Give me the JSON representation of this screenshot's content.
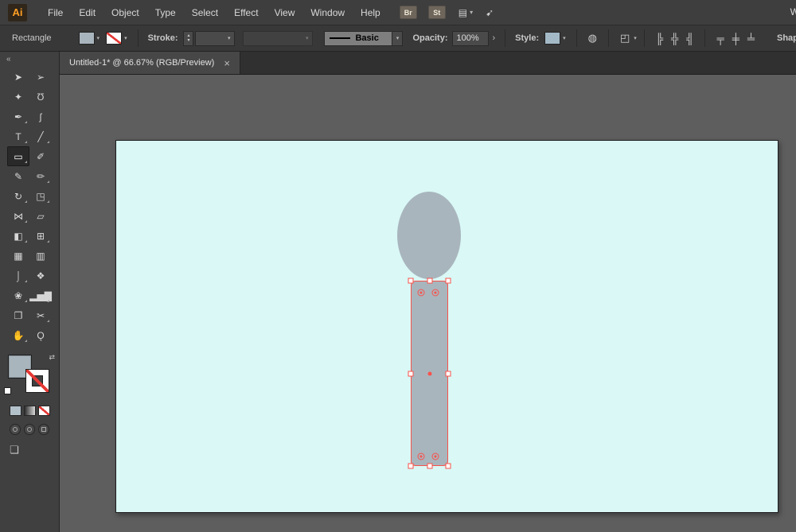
{
  "colors": {
    "menubar-bg": "#3e3e3e",
    "controlbar-bg": "#383838",
    "panel-bg": "#404040",
    "tabbar-bg": "#303030",
    "tab-bg": "#474747",
    "canvas-bg": "#5e5e5e",
    "artboard-bg": "#d9f8f6",
    "shape-fill": "#a9b5bd",
    "selection": "#f8524b",
    "text-light": "#d9d9d9",
    "logo-amber": "#ff9f24"
  },
  "menubar": {
    "logo": "Ai",
    "items": [
      "File",
      "Edit",
      "Object",
      "Type",
      "Select",
      "Effect",
      "View",
      "Window",
      "Help"
    ],
    "bridge_label": "Br",
    "stock_label": "St",
    "right_partial": "W"
  },
  "controlbar": {
    "context_label": "Rectangle",
    "stroke_label": "Stroke:",
    "stroke_weight_value": "",
    "brush_value": "Basic",
    "opacity_label": "Opacity:",
    "opacity_value": "100%",
    "style_label": "Style:",
    "shape_label": "Shape"
  },
  "tab": {
    "title": "Untitled-1* @ 66.67% (RGB/Preview)"
  },
  "icons": {
    "chevron_down": "▾",
    "chevron_right": "›",
    "stepper_up": "▴",
    "stepper_down": "▾",
    "arrange_documents": "▤",
    "gpu_performance": "➹",
    "swap_arrows": "⇄",
    "recolor_artwork": "◍",
    "select_similar": "◰",
    "align_h_left": "╠",
    "align_h_center": "╬",
    "align_h_right": "╣",
    "align_v_top": "╤",
    "align_v_center": "╪",
    "align_v_bottom": "╧",
    "screen_mode": "❏",
    "collapse_panel": "«",
    "close": "×"
  },
  "toolbar": {
    "tools": [
      {
        "name": "selection-tool",
        "glyph": "➤"
      },
      {
        "name": "direct-selection-tool",
        "glyph": "➢"
      },
      {
        "name": "magic-wand-tool",
        "glyph": "✦"
      },
      {
        "name": "lasso-tool",
        "glyph": "Ʊ"
      },
      {
        "name": "pen-tool",
        "glyph": "✒"
      },
      {
        "name": "curvature-tool",
        "glyph": "ʃ"
      },
      {
        "name": "type-tool",
        "glyph": "T"
      },
      {
        "name": "line-segment-tool",
        "glyph": "╱"
      },
      {
        "name": "rectangle-tool",
        "glyph": "▭",
        "selected": true
      },
      {
        "name": "paintbrush-tool",
        "glyph": "✐"
      },
      {
        "name": "shaper-tool",
        "glyph": "✎"
      },
      {
        "name": "pencil-tool",
        "glyph": "✏"
      },
      {
        "name": "rotate-tool",
        "glyph": "↻"
      },
      {
        "name": "scale-tool",
        "glyph": "◳"
      },
      {
        "name": "width-tool",
        "glyph": "⋈"
      },
      {
        "name": "free-transform-tool",
        "glyph": "▱"
      },
      {
        "name": "shape-builder-tool",
        "glyph": "◧"
      },
      {
        "name": "perspective-grid-tool",
        "glyph": "⊞"
      },
      {
        "name": "mesh-tool",
        "glyph": "▦"
      },
      {
        "name": "gradient-tool",
        "glyph": "▥"
      },
      {
        "name": "eyedropper-tool",
        "glyph": "⌡"
      },
      {
        "name": "blend-tool",
        "glyph": "❖"
      },
      {
        "name": "symbol-sprayer-tool",
        "glyph": "❀"
      },
      {
        "name": "column-graph-tool",
        "glyph": "▂▅▇"
      },
      {
        "name": "artboard-tool",
        "glyph": "❐"
      },
      {
        "name": "slice-tool",
        "glyph": "✂"
      },
      {
        "name": "hand-tool",
        "glyph": "✋"
      },
      {
        "name": "zoom-tool",
        "glyph": "Ǫ"
      }
    ]
  },
  "canvas": {
    "zoom": "66.67%",
    "artboard_color": "#d9f8f6",
    "selection_color": "#f8524b",
    "objects": [
      {
        "name": "ellipse",
        "fill": "#a9b5bd",
        "selected": false
      },
      {
        "name": "rounded-rectangle",
        "fill": "#a9b5bd",
        "selected": true
      }
    ]
  }
}
